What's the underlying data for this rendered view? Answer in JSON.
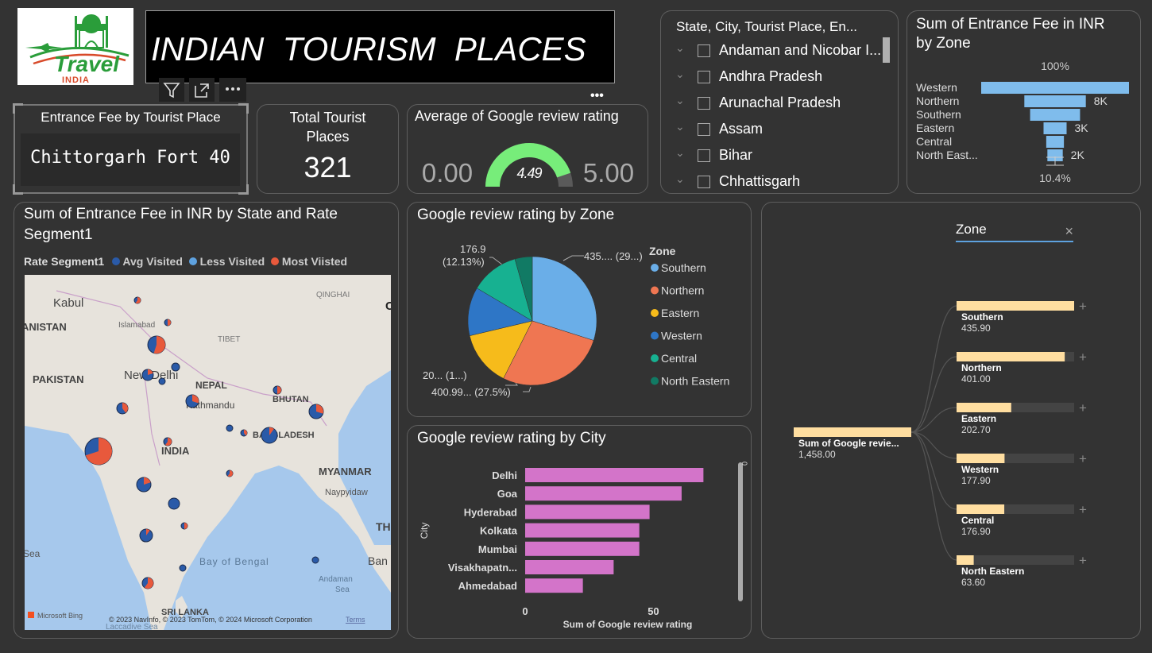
{
  "logo": {
    "line1": "Travel",
    "line2": "INDIA"
  },
  "header": {
    "title": "INDIAN  TOURISM  PLACES"
  },
  "visual_header": {
    "icons": [
      "filter-icon",
      "focus-mode-icon",
      "more-options-icon"
    ]
  },
  "card_entrance": {
    "title": "Entrance Fee by Tourist Place",
    "value": "Chittorgarh Fort 40"
  },
  "card_total": {
    "title_line1": "Total Tourist",
    "title_line2": "Places",
    "value": "321"
  },
  "gauge": {
    "title": "Average of Google review rating",
    "min_label": "0.00",
    "max_label": "5.00",
    "value_label": "4.49",
    "value": 4.49,
    "min": 0,
    "max": 5,
    "color": "#77ed7a"
  },
  "slicer": {
    "header": "State, City, Tourist Place, En...",
    "items": [
      "Andaman and Nicobar I...",
      "Andhra Pradesh",
      "Arunachal Pradesh",
      "Assam",
      "Bihar",
      "Chhattisgarh"
    ]
  },
  "funnel": {
    "title_line1": "Sum of Entrance Fee in INR",
    "title_line2": "by Zone",
    "top_label": "100%",
    "bottom_label": "10.4%"
  },
  "map": {
    "title_line1": "Sum of Entrance Fee in INR by State and Rate",
    "title_line2": "Segment1",
    "legend_title": "Rate Segment1",
    "legend": [
      {
        "label": "Avg Visited",
        "color": "#2a5aa8"
      },
      {
        "label": "Less Visited",
        "color": "#5ea2e0"
      },
      {
        "label": "Most Viisted",
        "color": "#e8593c"
      }
    ],
    "labels": {
      "kabul": "Kabul",
      "islamabad": "Islamabad",
      "afghanistan": "ANISTAN",
      "pakistan": "PAKISTAN",
      "qinghai": "QINGHAI",
      "tibet": "TIBET",
      "newdelhi": "New Delhi",
      "nepal": "NEPAL",
      "kathmandu": "Kathmandu",
      "bhutan": "BHUTAN",
      "bangladesh": "BANGLADESH",
      "india": "INDIA",
      "myanmar": "MYANMAR",
      "naypyidaw": "Naypyidaw",
      "th": "TH",
      "ban": "Ban",
      "sea": "Sea",
      "bay": "Bay of Bengal",
      "andaman": "Andaman",
      "andaman_sea": "Sea",
      "srilanka": "SRI LANKA",
      "laccadive": "Laccadive Sea",
      "c": "C"
    },
    "attribution": "© 2023 NavInfo, © 2023 TomTom, © 2024 Microsoft Corporation",
    "terms": "Terms",
    "bing": "Microsoft Bing"
  },
  "pie": {
    "title": "Google review rating by Zone",
    "legend_title": "Zone",
    "legend": [
      {
        "label": "Southern",
        "color": "#6aaee8"
      },
      {
        "label": "Northern",
        "color": "#ef7652"
      },
      {
        "label": "Eastern",
        "color": "#f6bb1b"
      },
      {
        "label": "Western",
        "color": "#2e76c6"
      },
      {
        "label": "Central",
        "color": "#17b191"
      },
      {
        "label": "North Eastern",
        "color": "#117a64"
      }
    ],
    "labels": {
      "southern": "435.... (29...)",
      "northern": "400.99... (27.5%)",
      "eastern": "20... (1...)",
      "central_l1": "176.9",
      "central_l2": "(12.13%)"
    }
  },
  "bar": {
    "title": "Google review rating by City",
    "ylabel": "City",
    "xlabel": "Sum of Google review rating",
    "scroll_label": "0",
    "ticks": [
      "0",
      "50"
    ]
  },
  "decomp": {
    "search_label": "Zone",
    "close_label": "×",
    "root_label": "Sum of Google revie...",
    "root_value": "1,458.00",
    "nodes": [
      {
        "label": "Southern",
        "value": "435.90"
      },
      {
        "label": "Northern",
        "value": "401.00"
      },
      {
        "label": "Eastern",
        "value": "202.70"
      },
      {
        "label": "Western",
        "value": "177.90"
      },
      {
        "label": "Central",
        "value": "176.90"
      },
      {
        "label": "North Eastern",
        "value": "63.60"
      }
    ],
    "expand_label": "+"
  },
  "chart_data": [
    {
      "type": "gauge",
      "title": "Average of Google review rating",
      "value": 4.49,
      "min": 0,
      "max": 5
    },
    {
      "type": "funnel",
      "title": "Sum of Entrance Fee in INR by Zone",
      "categories": [
        "Western",
        "Northern",
        "Southern",
        "Eastern",
        "Central",
        "North East..."
      ],
      "values": [
        19231,
        8000,
        6500,
        3000,
        2300,
        2000
      ],
      "data_labels": [
        "",
        "8K",
        "",
        "3K",
        "",
        "2K"
      ],
      "top_label": "100%",
      "bottom_label": "10.4%"
    },
    {
      "type": "pie",
      "title": "Google review rating by Zone",
      "categories": [
        "Southern",
        "Northern",
        "Eastern",
        "Western",
        "Central",
        "North Eastern"
      ],
      "values": [
        435.9,
        401.0,
        202.7,
        177.9,
        176.9,
        63.6
      ],
      "colors": [
        "#6aaee8",
        "#ef7652",
        "#f6bb1b",
        "#2e76c6",
        "#17b191",
        "#117a64"
      ],
      "legend": "right"
    },
    {
      "type": "bar",
      "orientation": "horizontal",
      "title": "Google review rating by City",
      "categories": [
        "Delhi",
        "Goa",
        "Hyderabad",
        "Kolkata",
        "Mumbai",
        "Visakhapatn...",
        "Ahmedabad"
      ],
      "values": [
        69.5,
        61,
        48.5,
        44.5,
        44.5,
        34.5,
        22.5
      ],
      "xlabel": "Sum of Google review rating",
      "ylabel": "City",
      "xlim": [
        0,
        70
      ],
      "xticks": [
        0,
        50
      ],
      "color": "#d374c9"
    },
    {
      "type": "decomposition-tree",
      "root": {
        "label": "Sum of Google revie...",
        "value": 1458.0
      },
      "level": "Zone",
      "categories": [
        "Southern",
        "Northern",
        "Eastern",
        "Western",
        "Central",
        "North Eastern"
      ],
      "values": [
        435.9,
        401.0,
        202.7,
        177.9,
        176.9,
        63.6
      ]
    },
    {
      "type": "map-bubble",
      "title": "Sum of Entrance Fee in INR by State and Rate Segment1",
      "series": [
        "Avg Visited",
        "Less Visited",
        "Most Viisted"
      ]
    }
  ]
}
